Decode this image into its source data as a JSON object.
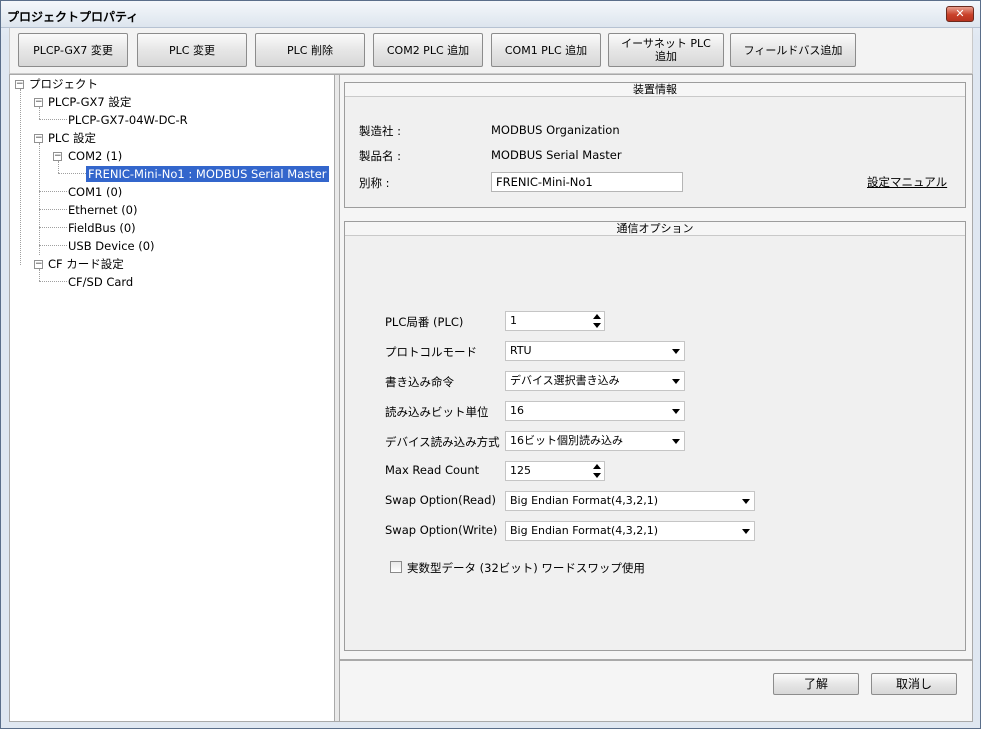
{
  "window": {
    "title": "プロジェクトプロパティ",
    "close_glyph": "✕"
  },
  "toolbar": {
    "buttons": [
      {
        "label": "PLCP-GX7 変更"
      },
      {
        "label": "PLC 変更"
      },
      {
        "label": "PLC 削除"
      },
      {
        "label": "COM2 PLC 追加"
      },
      {
        "label": "COM1 PLC 追加"
      },
      {
        "label": "イーサネット PLC\n追加"
      },
      {
        "label": "フィールドバス追加"
      }
    ]
  },
  "tree": {
    "project": "プロジェクト",
    "plcp_settings": "PLCP-GX7 設定",
    "plcp_model": "PLCP-GX7-04W-DC-R",
    "plc_settings": "PLC 設定",
    "com2": "COM2 (1)",
    "selected_device": "FRENIC-Mini-No1 : MODBUS Serial Master",
    "com1": "COM1 (0)",
    "ethernet": "Ethernet (0)",
    "fieldbus": "FieldBus (0)",
    "usb": "USB Device (0)",
    "cf_settings": "CF カード設定",
    "cf_card": "CF/SD Card",
    "expander_minus": "−"
  },
  "device_info": {
    "header": "装置情報",
    "manufacturer_label": "製造社 :",
    "manufacturer_value": "MODBUS Organization",
    "product_label": "製品名 :",
    "product_value": "MODBUS Serial Master",
    "alias_label": "別称 :",
    "alias_value": "FRENIC-Mini-No1",
    "manual_link": "設定マニュアル"
  },
  "comm_options": {
    "header": "通信オプション",
    "plc_station_label": "PLC局番 (PLC)",
    "plc_station_value": "1",
    "protocol_label": "プロトコルモード",
    "protocol_value": "RTU",
    "write_cmd_label": "書き込み命令",
    "write_cmd_value": "デバイス選択書き込み",
    "read_bit_label": "読み込みビット単位",
    "read_bit_value": "16",
    "device_read_label": "デバイス読み込み方式",
    "device_read_value": "16ビット個別読み込み",
    "max_read_label": "Max Read Count",
    "max_read_value": "125",
    "swap_read_label": "Swap Option(Read)",
    "swap_read_value": "Big Endian Format(4,3,2,1)",
    "swap_write_label": "Swap Option(Write)",
    "swap_write_value": "Big Endian Format(4,3,2,1)",
    "float_swap_label": "実数型データ (32ビット) ワードスワップ使用",
    "float_swap_checked": false
  },
  "footer": {
    "ok": "了解",
    "cancel": "取消し"
  }
}
